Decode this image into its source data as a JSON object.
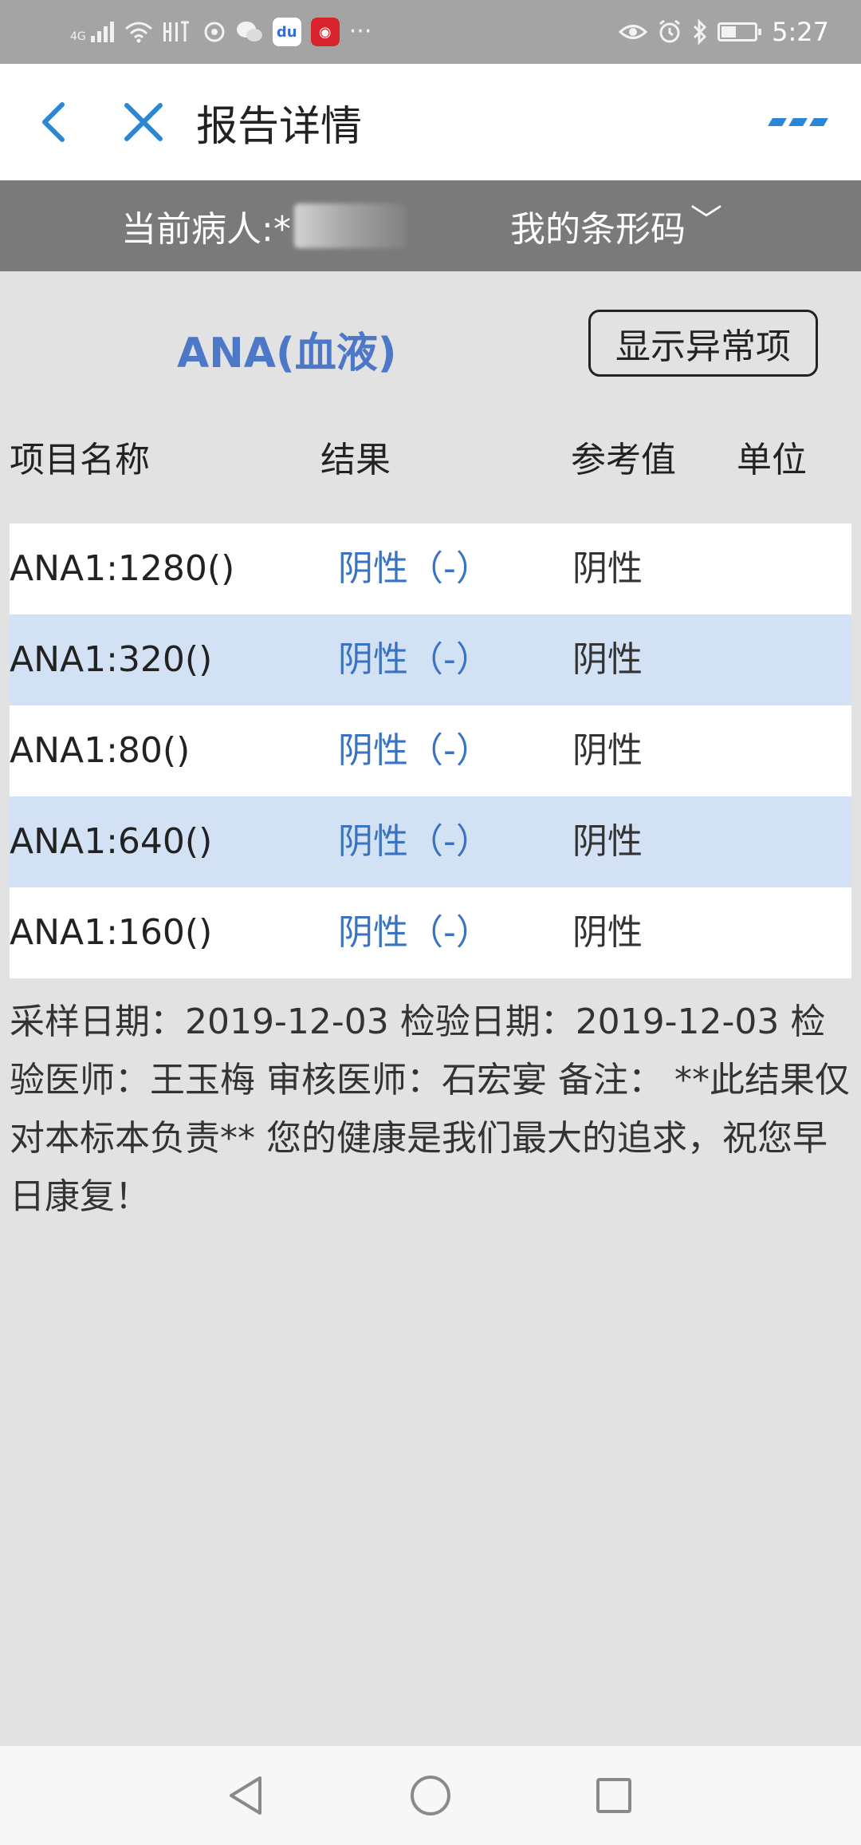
{
  "status_bar": {
    "network": "4G",
    "time": "5:27",
    "icons": [
      "signal-icon",
      "wifi-icon",
      "hd-icon",
      "settings-icon",
      "wechat-icon",
      "baidu-icon",
      "app-icon",
      "more-icon",
      "eye-icon",
      "alarm-icon",
      "bluetooth-icon",
      "battery-icon"
    ],
    "battery_level": 0.45
  },
  "header": {
    "title": "报告详情",
    "icons": [
      "back-icon",
      "close-icon",
      "more-icon"
    ],
    "accent_color": "#2a87d6"
  },
  "patient_bar": {
    "patient_label": "当前病人:*",
    "barcode_label": "我的条形码",
    "barcode_chevron": "﹀"
  },
  "report": {
    "title": "ANA(血液)",
    "show_abnormal_label": "显示异常项",
    "title_color": "#4d78c8"
  },
  "table": {
    "headers": {
      "name": "项目名称",
      "result": "结果",
      "reference": "参考值",
      "unit": "单位"
    },
    "rows": [
      {
        "name": "ANA1:1280()",
        "result": "阴性（-）",
        "reference": "阴性",
        "unit": ""
      },
      {
        "name": "ANA1:320()",
        "result": "阴性（-）",
        "reference": "阴性",
        "unit": ""
      },
      {
        "name": "ANA1:80()",
        "result": "阴性（-）",
        "reference": "阴性",
        "unit": ""
      },
      {
        "name": "ANA1:640()",
        "result": "阴性（-）",
        "reference": "阴性",
        "unit": ""
      },
      {
        "name": "ANA1:160()",
        "result": "阴性（-）",
        "reference": "阴性",
        "unit": ""
      }
    ],
    "row_colors": [
      "#ffffff",
      "#d2e2f4"
    ],
    "result_color": "#3a73c2"
  },
  "notes": {
    "text": "采样日期：2019-12-03 检验日期：2019-12-03 检验医师：王玉梅 审核医师：石宏宴 备注： **此结果仅对本标本负责** 您的健康是我们最大的追求，祝您早日康复！"
  },
  "nav_bar": {
    "icons": [
      "nav-back-icon",
      "nav-home-icon",
      "nav-recent-icon"
    ]
  }
}
